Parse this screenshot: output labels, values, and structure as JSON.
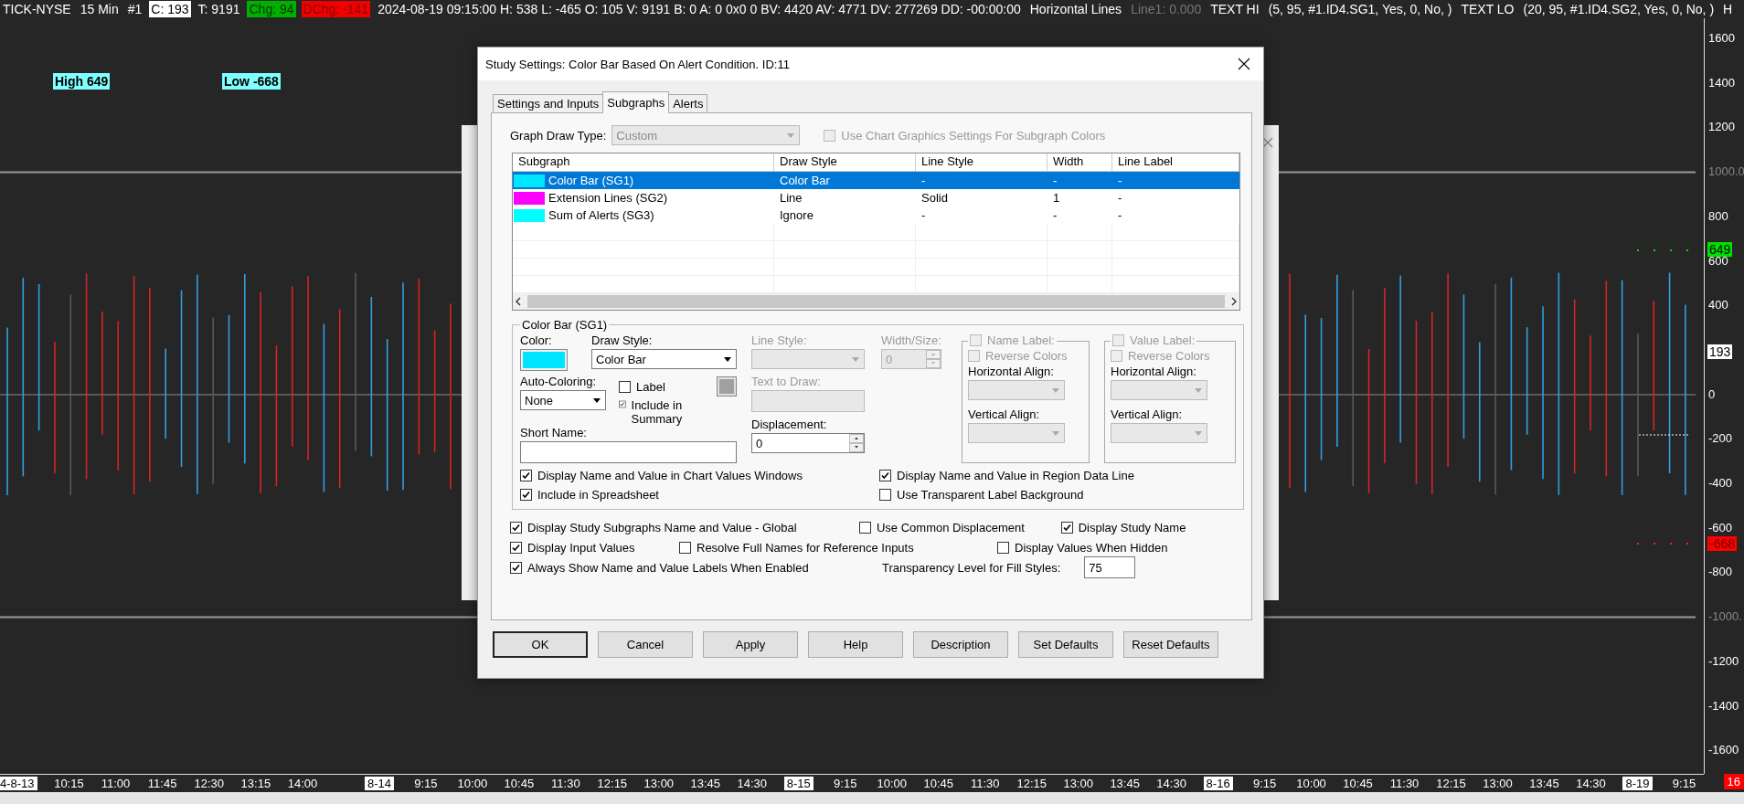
{
  "status_line": [
    {
      "text": "TICK-NYSE",
      "kind": "plain"
    },
    {
      "text": "15 Min",
      "kind": "plain"
    },
    {
      "text": "#1",
      "kind": "plain"
    },
    {
      "text": "C: 193",
      "kind": "white"
    },
    {
      "text": "T: 9191",
      "kind": "plain"
    },
    {
      "text": "Chg: 94",
      "kind": "green"
    },
    {
      "text": "DChg: -141",
      "kind": "red"
    },
    {
      "text": "2024-08-19 09:15:00 H: 538 L: -465 O: 105 V: 9191 B: 0 A: 0 0x0 0 BV: 4420 AV: 4771 DV: 277269 DD: -00:00:00",
      "kind": "plain"
    },
    {
      "text": "Horizontal Lines",
      "kind": "plain"
    },
    {
      "text": "Line1: 0.000",
      "kind": "dim"
    },
    {
      "text": "TEXT HI",
      "kind": "plain"
    },
    {
      "text": "(5, 95, #1.ID4.SG1, Yes, 0, No, )",
      "kind": "plain"
    },
    {
      "text": "TEXT LO",
      "kind": "plain"
    },
    {
      "text": "(20, 95, #1.ID4.SG2, Yes, 0, No, )",
      "kind": "plain"
    },
    {
      "text": "H",
      "kind": "plain"
    }
  ],
  "chart_labels": [
    {
      "text": "High 649"
    },
    {
      "text": "Low -668"
    }
  ],
  "price_axis": {
    "ticks": [
      {
        "text": "1600",
        "kind": "tick"
      },
      {
        "text": "1400",
        "kind": "tick"
      },
      {
        "text": "1200",
        "kind": "tick"
      },
      {
        "text": "1000.0",
        "kind": "line"
      },
      {
        "text": "800",
        "kind": "tick"
      },
      {
        "text": "600",
        "kind": "tick"
      },
      {
        "text": "400",
        "kind": "tick"
      },
      {
        "text": "0",
        "kind": "tick"
      },
      {
        "text": "-200",
        "kind": "tick"
      },
      {
        "text": "-400",
        "kind": "tick"
      },
      {
        "text": "-600",
        "kind": "tick"
      },
      {
        "text": "-800",
        "kind": "tick"
      },
      {
        "text": "-1000.",
        "kind": "line"
      },
      {
        "text": "-1200",
        "kind": "tick"
      },
      {
        "text": "-1400",
        "kind": "tick"
      },
      {
        "text": "-1600",
        "kind": "tick"
      }
    ],
    "markers": [
      {
        "text": "649",
        "color": "#00e000"
      },
      {
        "text": "193",
        "color": "#ffffff"
      },
      {
        "text": "-668",
        "color": "#ff0000"
      }
    ],
    "corner": {
      "text": "16",
      "color": "#ff0000"
    }
  },
  "time_axis": [
    {
      "text": "4-8-13",
      "kind": "date"
    },
    {
      "text": "10:15",
      "kind": "time"
    },
    {
      "text": "11:00",
      "kind": "time"
    },
    {
      "text": "11:45",
      "kind": "time"
    },
    {
      "text": "12:30",
      "kind": "time"
    },
    {
      "text": "13:15",
      "kind": "time"
    },
    {
      "text": "14:00",
      "kind": "time"
    },
    {
      "text": "8-14",
      "kind": "date"
    },
    {
      "text": "9:15",
      "kind": "time"
    },
    {
      "text": "10:00",
      "kind": "time"
    },
    {
      "text": "10:45",
      "kind": "time"
    },
    {
      "text": "11:30",
      "kind": "time"
    },
    {
      "text": "12:15",
      "kind": "time"
    },
    {
      "text": "13:00",
      "kind": "time"
    },
    {
      "text": "13:45",
      "kind": "time"
    },
    {
      "text": "14:30",
      "kind": "time"
    },
    {
      "text": "8-15",
      "kind": "date"
    },
    {
      "text": "9:15",
      "kind": "time"
    },
    {
      "text": "10:00",
      "kind": "time"
    },
    {
      "text": "10:45",
      "kind": "time"
    },
    {
      "text": "11:30",
      "kind": "time"
    },
    {
      "text": "12:15",
      "kind": "time"
    },
    {
      "text": "13:00",
      "kind": "time"
    },
    {
      "text": "13:45",
      "kind": "time"
    },
    {
      "text": "14:30",
      "kind": "time"
    },
    {
      "text": "8-16",
      "kind": "date"
    },
    {
      "text": "9:15",
      "kind": "time"
    },
    {
      "text": "10:00",
      "kind": "time"
    },
    {
      "text": "10:45",
      "kind": "time"
    },
    {
      "text": "11:30",
      "kind": "time"
    },
    {
      "text": "12:15",
      "kind": "time"
    },
    {
      "text": "13:00",
      "kind": "time"
    },
    {
      "text": "13:45",
      "kind": "time"
    },
    {
      "text": "14:30",
      "kind": "time"
    },
    {
      "text": "8-19",
      "kind": "date"
    },
    {
      "text": "9:15",
      "kind": "time"
    }
  ],
  "dialog": {
    "title": "Study Settings: Color Bar Based On Alert Condition. ID:11",
    "tabs": [
      {
        "label": "Settings and Inputs",
        "selected": false
      },
      {
        "label": "Subgraphs",
        "selected": true
      },
      {
        "label": "Alerts",
        "selected": false
      }
    ],
    "graph_draw_type": {
      "label": "Graph Draw Type:",
      "value": "Custom",
      "disabled": true
    },
    "use_chart_graphics": {
      "label": "Use Chart Graphics Settings For Subgraph Colors",
      "checked": false,
      "disabled": true
    },
    "table": {
      "columns": [
        "Subgraph",
        "Draw Style",
        "Line Style",
        "Width",
        "Line Label"
      ],
      "rows": [
        {
          "color": "#00e5ff",
          "cells": [
            "Color Bar (SG1)",
            "Color Bar",
            "-",
            "-",
            "-"
          ],
          "selected": true
        },
        {
          "color": "#ff00ff",
          "cells": [
            "Extension Lines (SG2)",
            "Line",
            "Solid",
            "1",
            "-"
          ],
          "selected": false
        },
        {
          "color": "#00ffff",
          "cells": [
            "Sum of Alerts (SG3)",
            "Ignore",
            "-",
            "-",
            "-"
          ],
          "selected": false
        }
      ]
    },
    "group": {
      "legend": "Color Bar (SG1)",
      "color_label": "Color:",
      "draw_style": {
        "label": "Draw Style:",
        "value": "Color Bar"
      },
      "auto_coloring": {
        "label": "Auto-Coloring:",
        "value": "None"
      },
      "label_checkbox": {
        "label": "Label",
        "checked": false
      },
      "include_in_summary": {
        "label": "Include in Summary",
        "checked": true
      },
      "short_name": {
        "label": "Short Name:"
      },
      "line_style": {
        "label": "Line Style:",
        "disabled": true
      },
      "text_to_draw": {
        "label": "Text to Draw:",
        "disabled": true
      },
      "displacement": {
        "label": "Displacement:",
        "value": "0"
      },
      "width_size": {
        "label": "Width/Size:",
        "value": "0",
        "disabled": true
      },
      "label_boxes": [
        {
          "label": "Name Label:",
          "checked": false,
          "disabled": true,
          "reverse_colors": "Reverse Colors",
          "horizontal_align": "Horizontal Align:",
          "vertical_align": "Vertical Align:"
        },
        {
          "label": "Value Label:",
          "checked": false,
          "disabled": true,
          "reverse_colors": "Reverse Colors",
          "horizontal_align": "Horizontal Align:",
          "vertical_align": "Vertical Align:"
        }
      ],
      "checks": [
        {
          "label": "Display Name and Value in Chart Values Windows",
          "checked": true
        },
        {
          "label": "Display Name and Value in Region Data Line",
          "checked": true
        },
        {
          "label": "Include in Spreadsheet",
          "checked": true
        },
        {
          "label": "Use Transparent Label Background",
          "checked": false
        }
      ]
    },
    "options": [
      [
        {
          "kind": "checkbox",
          "label": "Display Study Subgraphs Name and Value - Global",
          "checked": true
        },
        {
          "kind": "checkbox",
          "label": "Use Common Displacement",
          "checked": false
        },
        {
          "kind": "checkbox",
          "label": "Display Study Name",
          "checked": true
        }
      ],
      [
        {
          "kind": "checkbox",
          "label": "Display Input Values",
          "checked": true
        },
        {
          "kind": "checkbox",
          "label": "Resolve Full Names for Reference Inputs",
          "checked": false
        },
        {
          "kind": "checkbox",
          "label": "Display Values When Hidden",
          "checked": false
        }
      ],
      [
        {
          "kind": "checkbox",
          "label": "Always Show Name and Value Labels When Enabled",
          "checked": true
        },
        {
          "kind": "number_field",
          "label": "Transparency Level for Fill Styles:",
          "value": "75"
        }
      ]
    ],
    "buttons": [
      {
        "label": "OK",
        "default": true
      },
      {
        "label": "Cancel",
        "default": false
      },
      {
        "label": "Apply",
        "default": false
      },
      {
        "label": "Help",
        "default": false
      },
      {
        "label": "Description",
        "default": false
      },
      {
        "label": "Set Defaults",
        "default": false
      },
      {
        "label": "Reset Defaults",
        "default": false
      }
    ]
  }
}
